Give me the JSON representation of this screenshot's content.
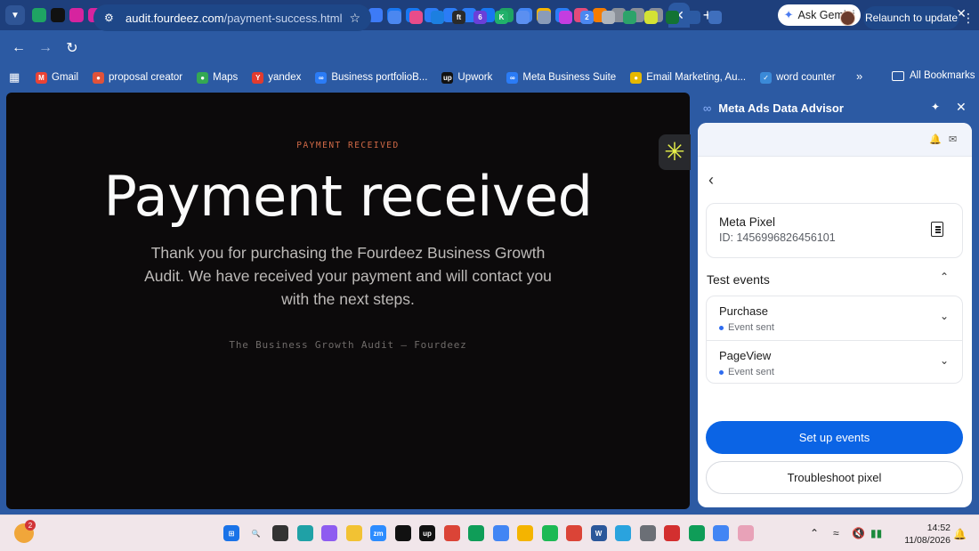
{
  "browser": {
    "tab_favicons": [
      {
        "name": "sheets-icon",
        "color": "#1fa463"
      },
      {
        "name": "framer-icon",
        "color": "#111111"
      },
      {
        "name": "instagram-icon",
        "color": "#d6249f"
      },
      {
        "name": "instagram-icon",
        "color": "#d6249f"
      },
      {
        "name": "instagram-icon",
        "color": "#d6249f"
      },
      {
        "name": "meta-icon",
        "color": "#2b7cf6"
      },
      {
        "name": "meta-icon",
        "color": "#2b7cf6"
      },
      {
        "name": "instagram-icon",
        "color": "#d6249f"
      },
      {
        "name": "instagram-icon",
        "color": "#d6249f"
      },
      {
        "name": "linkedin-icon",
        "color": "#0a66c2"
      },
      {
        "name": "linkedin-icon",
        "color": "#0a66c2"
      },
      {
        "name": "compass-icon",
        "color": "#3b8ad8"
      },
      {
        "name": "asterisk-icon",
        "color": "#d4e234"
      },
      {
        "name": "compass-icon",
        "color": "#9aa0a6"
      },
      {
        "name": "linkedin-icon",
        "color": "#0a66c2"
      },
      {
        "name": "compass-icon",
        "color": "#3b8ad8"
      },
      {
        "name": "opera-icon",
        "color": "#e0323a"
      },
      {
        "name": "gmail-icon",
        "color": "#ea4335"
      },
      {
        "name": "messenger-icon",
        "color": "#3d7bf7"
      },
      {
        "name": "facebook-icon",
        "color": "#1877f2"
      },
      {
        "name": "facebook-icon",
        "color": "#1877f2"
      },
      {
        "name": "meta-icon",
        "color": "#2b7cf6"
      },
      {
        "name": "meta-icon",
        "color": "#2b7cf6"
      },
      {
        "name": "meta-icon",
        "color": "#2b7cf6"
      },
      {
        "name": "facebook-icon",
        "color": "#1877f2"
      },
      {
        "name": "drive-icon",
        "color": "#1fa463"
      },
      {
        "name": "docs-icon",
        "color": "#4285f4"
      },
      {
        "name": "pdf-icon",
        "color": "#f4b400"
      },
      {
        "name": "meta-icon",
        "color": "#2b7cf6"
      },
      {
        "name": "equals-icon",
        "color": "#e34b7a"
      },
      {
        "name": "flame-icon",
        "color": "#f57c00"
      },
      {
        "name": "globe-icon",
        "color": "#8a8f98"
      },
      {
        "name": "globe-icon",
        "color": "#8a8f98"
      },
      {
        "name": "globe-icon",
        "color": "#8a8f98"
      }
    ],
    "ask_gemini_label": "Ask Gemini",
    "url_domain": "audit.fourdeez.com",
    "url_path": "/payment-success.html",
    "relaunch_label": "Relaunch to update",
    "extension_icons": [
      {
        "name": "extension-cloud-icon",
        "color": "#4b87f0",
        "glyph": ""
      },
      {
        "name": "extension-color-icon",
        "color": "#e84c8a",
        "glyph": ""
      },
      {
        "name": "extension-gear-icon",
        "color": "#1c7fe0",
        "glyph": ""
      },
      {
        "name": "extension-ft-icon",
        "color": "#2a2a2a",
        "glyph": "ft"
      },
      {
        "name": "extension-badge-icon",
        "color": "#6a3fd8",
        "glyph": "6"
      },
      {
        "name": "extension-k-icon",
        "color": "#21b16b",
        "glyph": "K"
      },
      {
        "name": "extension-doc-icon",
        "color": "#5b8ff0",
        "glyph": ""
      },
      {
        "name": "extension-camera-icon",
        "color": "#8a9bb8",
        "glyph": ""
      },
      {
        "name": "extension-download-icon",
        "color": "#c43de0",
        "glyph": ""
      },
      {
        "name": "extension-swap-icon",
        "color": "#4b87f0",
        "glyph": "2"
      },
      {
        "name": "extension-shield-icon",
        "color": "#b1b6bd",
        "glyph": ""
      },
      {
        "name": "extension-gift-icon",
        "color": "#2ca36a",
        "glyph": ""
      },
      {
        "name": "extension-asterisk-icon",
        "color": "#d4e234",
        "glyph": ""
      },
      {
        "name": "extension-check-icon",
        "color": "#137333",
        "glyph": ""
      },
      {
        "name": "extensions-puzzle-icon",
        "color": "#2c5aa3",
        "glyph": ""
      },
      {
        "name": "side-panel-icon",
        "color": "#3f6fbd",
        "glyph": ""
      }
    ],
    "bookmarks": [
      {
        "label": "Gmail",
        "icon": "gmail-icon",
        "color": "#ea4335",
        "glyph": "M"
      },
      {
        "label": "proposal creator",
        "icon": "proposal-icon",
        "color": "#e0523a",
        "glyph": "●"
      },
      {
        "label": "Maps",
        "icon": "maps-pin-icon",
        "color": "#34a853",
        "glyph": "●"
      },
      {
        "label": "yandex",
        "icon": "yandex-icon",
        "color": "#e23b2e",
        "glyph": "Y"
      },
      {
        "label": "Business portfolioB...",
        "icon": "meta-icon",
        "color": "#2b7cf6",
        "glyph": "∞"
      },
      {
        "label": "Upwork",
        "icon": "upwork-icon",
        "color": "#111111",
        "glyph": "up"
      },
      {
        "label": "Meta Business Suite",
        "icon": "meta-icon",
        "color": "#2b7cf6",
        "glyph": "∞"
      },
      {
        "label": "Email Marketing, Au...",
        "icon": "mailchimp-icon",
        "color": "#e6b800",
        "glyph": "●"
      },
      {
        "label": "word counter",
        "icon": "word-counter-icon",
        "color": "#3b8ad8",
        "glyph": "✓"
      }
    ],
    "all_bookmarks_label": "All Bookmarks"
  },
  "page": {
    "eyebrow": "PAYMENT RECEIVED",
    "title": "Payment received",
    "body": "Thank you for purchasing the Fourdeez Business Growth Audit. We have received your payment and will contact you with the next steps.",
    "footer_note": "The Business Growth Audit — Fourdeez",
    "widget_glyph": "✳"
  },
  "side_panel": {
    "title": "Meta Ads Data Advisor",
    "pixel_name": "Meta Pixel",
    "pixel_id": "ID: 1456996826456101",
    "section_title": "Test events",
    "events": [
      {
        "name": "Purchase",
        "status": "Event sent"
      },
      {
        "name": "PageView",
        "status": "Event sent"
      }
    ],
    "primary_button": "Set up events",
    "secondary_button": "Troubleshoot pixel",
    "accent_color": "#0b64e5"
  },
  "taskbar": {
    "weather_badge": "2",
    "icons": [
      {
        "name": "windows-start-icon",
        "color": "#1a73e8",
        "glyph": "⊞"
      },
      {
        "name": "search-icon",
        "color": "#f1e6ea",
        "glyph": "🔍"
      },
      {
        "name": "task-view-icon",
        "color": "#333333",
        "glyph": ""
      },
      {
        "name": "edge-icon",
        "color": "#1fa1a6",
        "glyph": ""
      },
      {
        "name": "copilot-icon",
        "color": "#8e5cf0",
        "glyph": ""
      },
      {
        "name": "file-explorer-icon",
        "color": "#f2c233",
        "glyph": ""
      },
      {
        "name": "zoom-icon",
        "color": "#2d8cff",
        "glyph": "zm"
      },
      {
        "name": "capcut-icon",
        "color": "#111111",
        "glyph": ""
      },
      {
        "name": "upwork-icon",
        "color": "#111111",
        "glyph": "up"
      },
      {
        "name": "chrome-icon",
        "color": "#db4437",
        "glyph": ""
      },
      {
        "name": "chrome-icon",
        "color": "#0f9d58",
        "glyph": ""
      },
      {
        "name": "chrome-icon",
        "color": "#4285f4",
        "glyph": ""
      },
      {
        "name": "chrome-icon",
        "color": "#f4b400",
        "glyph": ""
      },
      {
        "name": "spotify-icon",
        "color": "#1db954",
        "glyph": ""
      },
      {
        "name": "chrome-icon",
        "color": "#db4437",
        "glyph": ""
      },
      {
        "name": "word-icon",
        "color": "#2b579a",
        "glyph": "W"
      },
      {
        "name": "telegram-icon",
        "color": "#2aa3de",
        "glyph": ""
      },
      {
        "name": "settings-gear-icon",
        "color": "#6b6f76",
        "glyph": ""
      },
      {
        "name": "recorder-icon",
        "color": "#d32f2f",
        "glyph": ""
      },
      {
        "name": "chrome-icon",
        "color": "#0f9d58",
        "glyph": ""
      },
      {
        "name": "chrome-icon",
        "color": "#4285f4",
        "glyph": ""
      },
      {
        "name": "snipping-tool-icon",
        "color": "#e8a2b8",
        "glyph": ""
      }
    ],
    "time": "14:52",
    "date": "11/08/2026"
  }
}
